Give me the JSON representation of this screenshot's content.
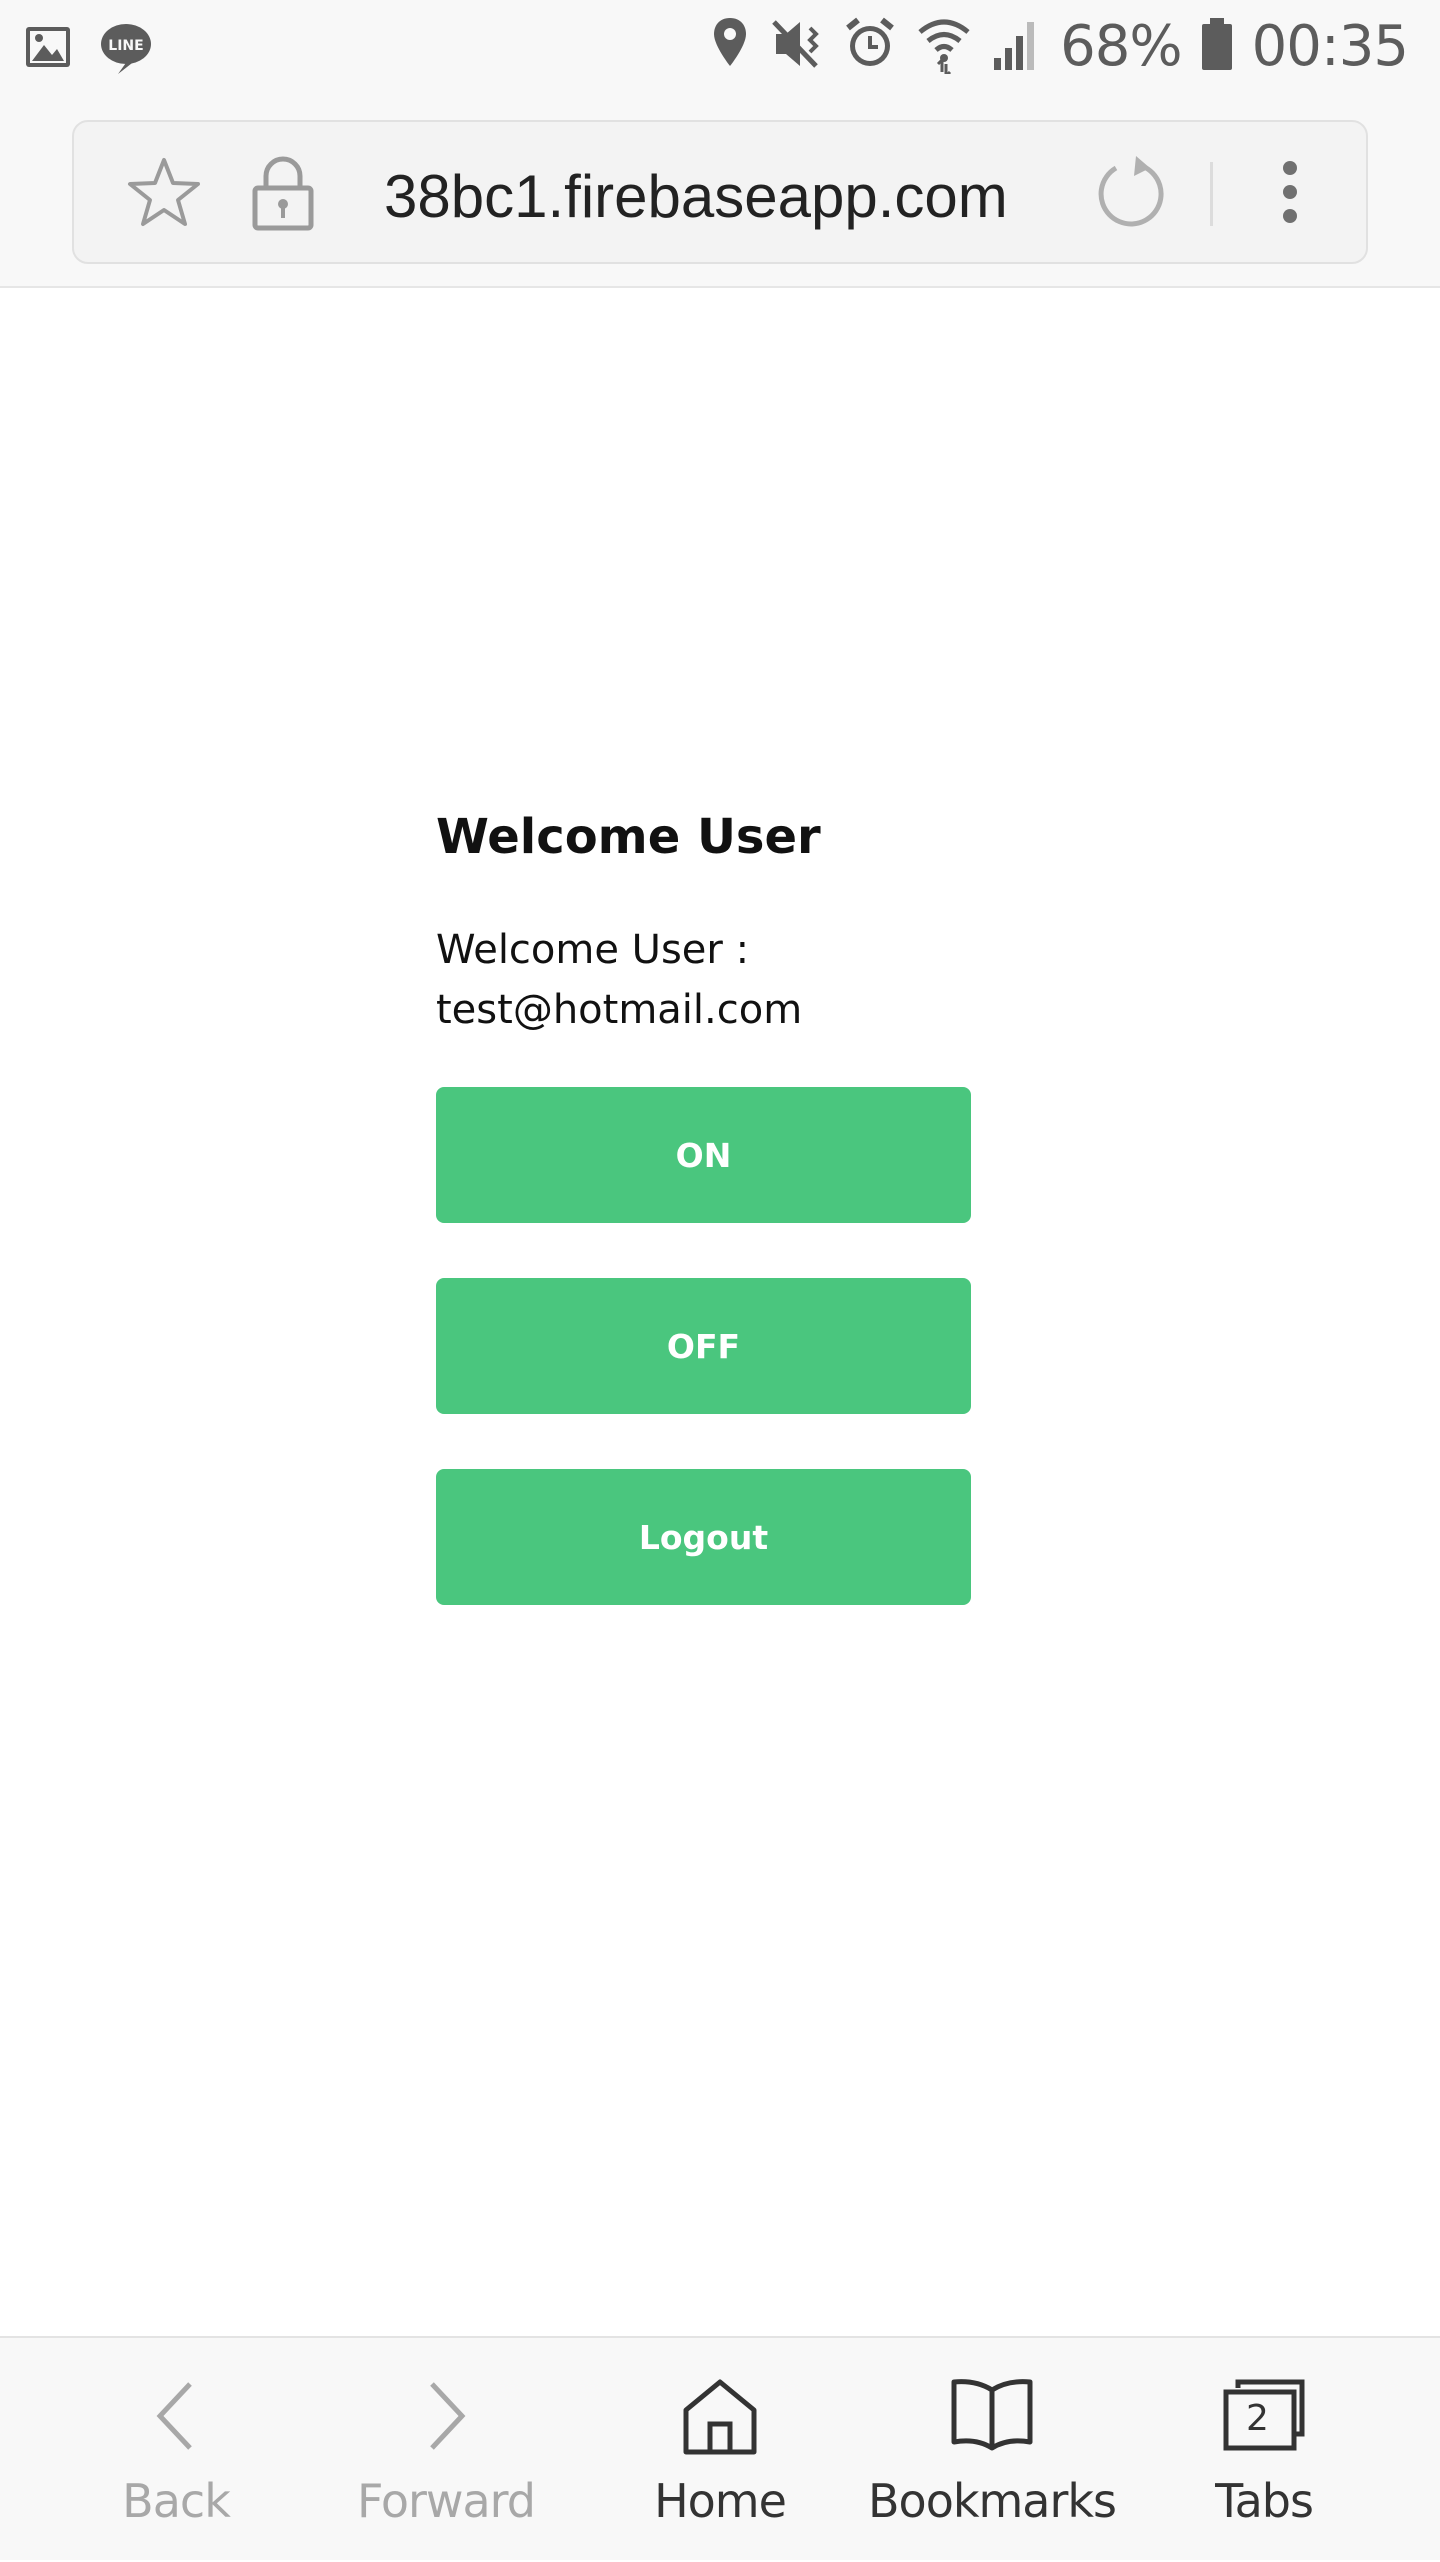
{
  "status_bar": {
    "battery": "68%",
    "time": "00:35"
  },
  "address_bar": {
    "url": "38bc1.firebaseapp.com"
  },
  "page": {
    "title": "Welcome User",
    "welcome_text": "Welcome User :\ntest@hotmail.com",
    "buttons": {
      "on": "ON",
      "off": "OFF",
      "logout": "Logout"
    },
    "button_color": "#4ac67e"
  },
  "bottom_nav": {
    "back": "Back",
    "forward": "Forward",
    "home": "Home",
    "bookmarks": "Bookmarks",
    "tabs": "Tabs",
    "tab_count": "2"
  }
}
